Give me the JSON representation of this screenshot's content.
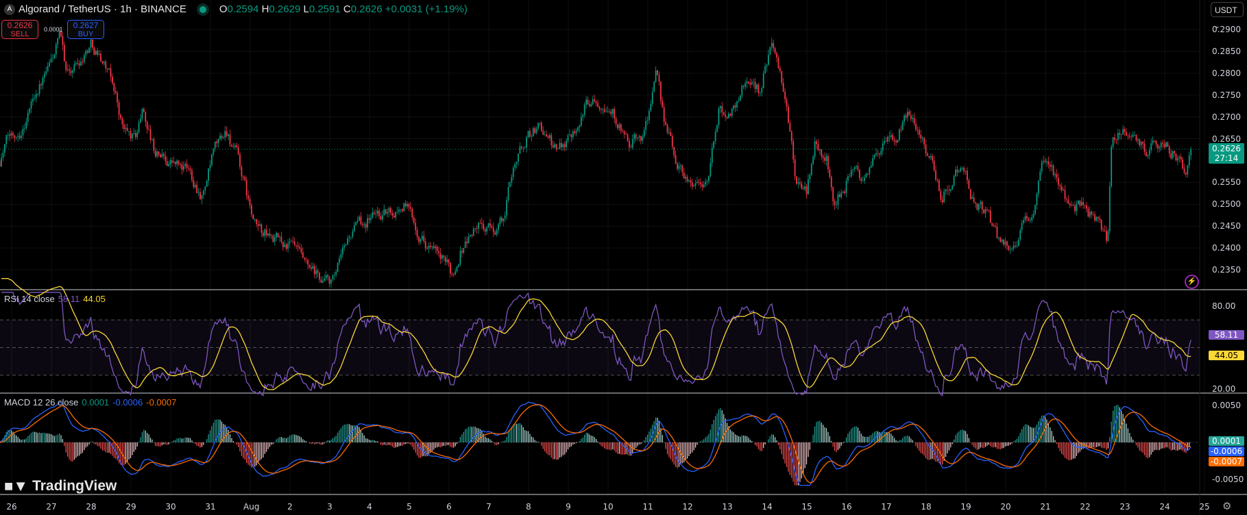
{
  "header": {
    "symbol": "Algorand / TetherUS · 1h · BINANCE",
    "icon": "algorand-logo",
    "ohlc": {
      "o_label": "O",
      "o": "0.2594",
      "h_label": "H",
      "h": "0.2629",
      "l_label": "L",
      "l": "0.2591",
      "c_label": "C",
      "c": "0.2626",
      "change": "+0.0031 (+1.19%)"
    }
  },
  "trade": {
    "sell_price": "0.2626",
    "sell_label": "SELL",
    "buy_price": "0.2627",
    "buy_label": "BUY",
    "spread": "0.0001"
  },
  "currency": "USDT",
  "brand": "TradingView",
  "colors": {
    "up": "#089981",
    "down": "#f23645",
    "rsi": "#7e57c2",
    "rsi_ma": "#fdd835",
    "macd": "#2962ff",
    "signal": "#ff6d00"
  },
  "chart_data": [
    {
      "type": "candlestick",
      "title": "Algorand / TetherUS 1h",
      "interval_hours": 1,
      "price_ticks": [
        "0.2900",
        "0.2850",
        "0.2800",
        "0.2750",
        "0.2700",
        "0.2650",
        "0.2550",
        "0.2500",
        "0.2450",
        "0.2400",
        "0.2350"
      ],
      "ylim": [
        0.2315,
        0.2905
      ],
      "last_price": "0.2626",
      "countdown": "27:14",
      "x_ticks": [
        "26",
        "27",
        "28",
        "29",
        "30",
        "31",
        "Aug",
        "2",
        "3",
        "4",
        "5",
        "6",
        "7",
        "8",
        "9",
        "10",
        "11",
        "12",
        "13",
        "14",
        "15",
        "16",
        "17",
        "18",
        "19",
        "20",
        "21",
        "22",
        "23",
        "24",
        "25"
      ],
      "path_days_price": [
        [
          -0.3,
          0.26
        ],
        [
          -0.1,
          0.265
        ],
        [
          0.3,
          0.268
        ],
        [
          0.6,
          0.276
        ],
        [
          0.9,
          0.28
        ],
        [
          1.2,
          0.288
        ],
        [
          1.4,
          0.28
        ],
        [
          1.7,
          0.283
        ],
        [
          2.0,
          0.287
        ],
        [
          2.3,
          0.283
        ],
        [
          2.6,
          0.276
        ],
        [
          2.8,
          0.267
        ],
        [
          3.1,
          0.265
        ],
        [
          3.3,
          0.272
        ],
        [
          3.6,
          0.262
        ],
        [
          4.0,
          0.26
        ],
        [
          4.5,
          0.257
        ],
        [
          4.8,
          0.252
        ],
        [
          5.1,
          0.262
        ],
        [
          5.4,
          0.267
        ],
        [
          5.7,
          0.26
        ],
        [
          6.1,
          0.245
        ],
        [
          6.6,
          0.242
        ],
        [
          7.1,
          0.24
        ],
        [
          7.4,
          0.235
        ],
        [
          7.7,
          0.233
        ],
        [
          8.1,
          0.232
        ],
        [
          8.5,
          0.243
        ],
        [
          9.1,
          0.248
        ],
        [
          9.5,
          0.248
        ],
        [
          9.9,
          0.25
        ],
        [
          10.3,
          0.243
        ],
        [
          10.7,
          0.238
        ],
        [
          11.1,
          0.234
        ],
        [
          11.3,
          0.24
        ],
        [
          11.7,
          0.245
        ],
        [
          12.1,
          0.244
        ],
        [
          12.4,
          0.247
        ],
        [
          12.6,
          0.259
        ],
        [
          13.0,
          0.266
        ],
        [
          13.3,
          0.268
        ],
        [
          13.7,
          0.262
        ],
        [
          14.1,
          0.267
        ],
        [
          14.6,
          0.275
        ],
        [
          14.9,
          0.274
        ],
        [
          15.2,
          0.27
        ],
        [
          15.5,
          0.263
        ],
        [
          15.9,
          0.266
        ],
        [
          16.2,
          0.279
        ],
        [
          16.4,
          0.27
        ],
        [
          16.7,
          0.26
        ],
        [
          17.1,
          0.255
        ],
        [
          17.5,
          0.255
        ],
        [
          17.8,
          0.272
        ],
        [
          18.1,
          0.271
        ],
        [
          18.5,
          0.279
        ],
        [
          18.8,
          0.276
        ],
        [
          19.1,
          0.287
        ],
        [
          19.5,
          0.272
        ],
        [
          19.7,
          0.256
        ],
        [
          20.0,
          0.253
        ],
        [
          20.2,
          0.264
        ],
        [
          20.5,
          0.26
        ],
        [
          20.7,
          0.25
        ],
        [
          21.1,
          0.257
        ],
        [
          21.5,
          0.256
        ],
        [
          21.8,
          0.263
        ],
        [
          22.2,
          0.264
        ],
        [
          22.6,
          0.271
        ],
        [
          22.9,
          0.266
        ],
        [
          23.2,
          0.258
        ],
        [
          23.4,
          0.252
        ],
        [
          23.7,
          0.257
        ],
        [
          24.0,
          0.258
        ],
        [
          24.2,
          0.25
        ],
        [
          24.5,
          0.248
        ],
        [
          24.8,
          0.242
        ],
        [
          25.1,
          0.241
        ],
        [
          25.4,
          0.244
        ],
        [
          25.7,
          0.249
        ],
        [
          25.9,
          0.258
        ],
        [
          26.2,
          0.257
        ],
        [
          26.5,
          0.252
        ],
        [
          26.9,
          0.249
        ],
        [
          27.3,
          0.247
        ],
        [
          27.56,
          0.241
        ],
        [
          27.66,
          0.262
        ],
        [
          27.9,
          0.268
        ],
        [
          28.1,
          0.266
        ],
        [
          28.5,
          0.262
        ],
        [
          28.9,
          0.265
        ],
        [
          29.2,
          0.262
        ],
        [
          29.5,
          0.257
        ],
        [
          29.66,
          0.2626
        ]
      ]
    },
    {
      "type": "line",
      "title": "RSI 14 close",
      "label": "RSI 14 close",
      "rsi": "58.11",
      "rsi_ma": "44.05",
      "ticks": [
        "80.00",
        "20.00"
      ],
      "ylim": [
        20,
        80
      ],
      "bands": [
        70,
        50,
        30
      ]
    },
    {
      "type": "bar+line",
      "title": "MACD 12 26 close",
      "label": "MACD 12 26 close",
      "histogram": "0.0001",
      "macd": "-0.0006",
      "signal": "-0.0007",
      "ticks": [
        "0.0050",
        "-0.0050"
      ],
      "ylim": [
        -0.005,
        0.005
      ]
    }
  ]
}
